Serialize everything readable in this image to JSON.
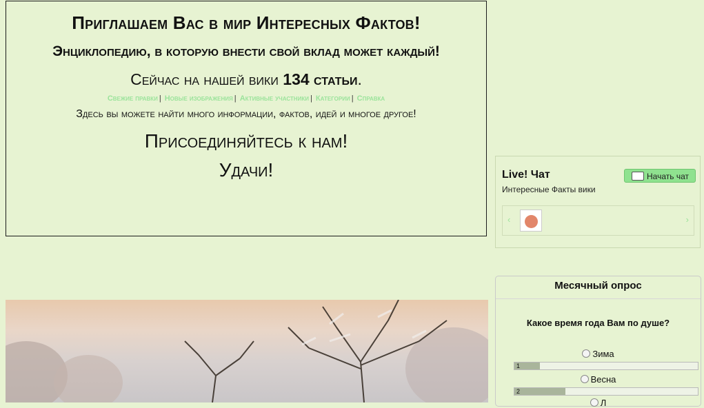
{
  "welcome": {
    "title": "Приглашаем Вас в мир Интересных Фактов!",
    "subtitle": "Энциклопедию, в которую внести свой вклад может каждый!",
    "count_prefix": "Сейчас на нашей вики",
    "count_value": "134 статьи",
    "count_suffix": ".",
    "links": [
      "Свежие правки",
      "Новые изображения",
      "Активные участники",
      "Категории",
      "Справка"
    ],
    "description": "Здесь вы можете найти много информации, фактов, идей и многое другое!",
    "join": "Присоединяйтесь к нам!",
    "luck": "Удачи!"
  },
  "chat": {
    "title": "Live! Чат",
    "subtitle": "Интересные Факты вики",
    "button_label": "Начать чат",
    "icons": {
      "bubble": "speech-bubble-icon",
      "left": "‹",
      "right": "›"
    },
    "accent": "#8fe28f"
  },
  "poll": {
    "header": "Месячный опрос",
    "question": "Какое время года Вам по душе?",
    "options": [
      {
        "label": "Зима",
        "votes": "1",
        "fill": 0.14
      },
      {
        "label": "Весна",
        "votes": "2",
        "fill": 0.28
      },
      {
        "label": "Л",
        "votes": "",
        "fill": 0
      }
    ]
  }
}
